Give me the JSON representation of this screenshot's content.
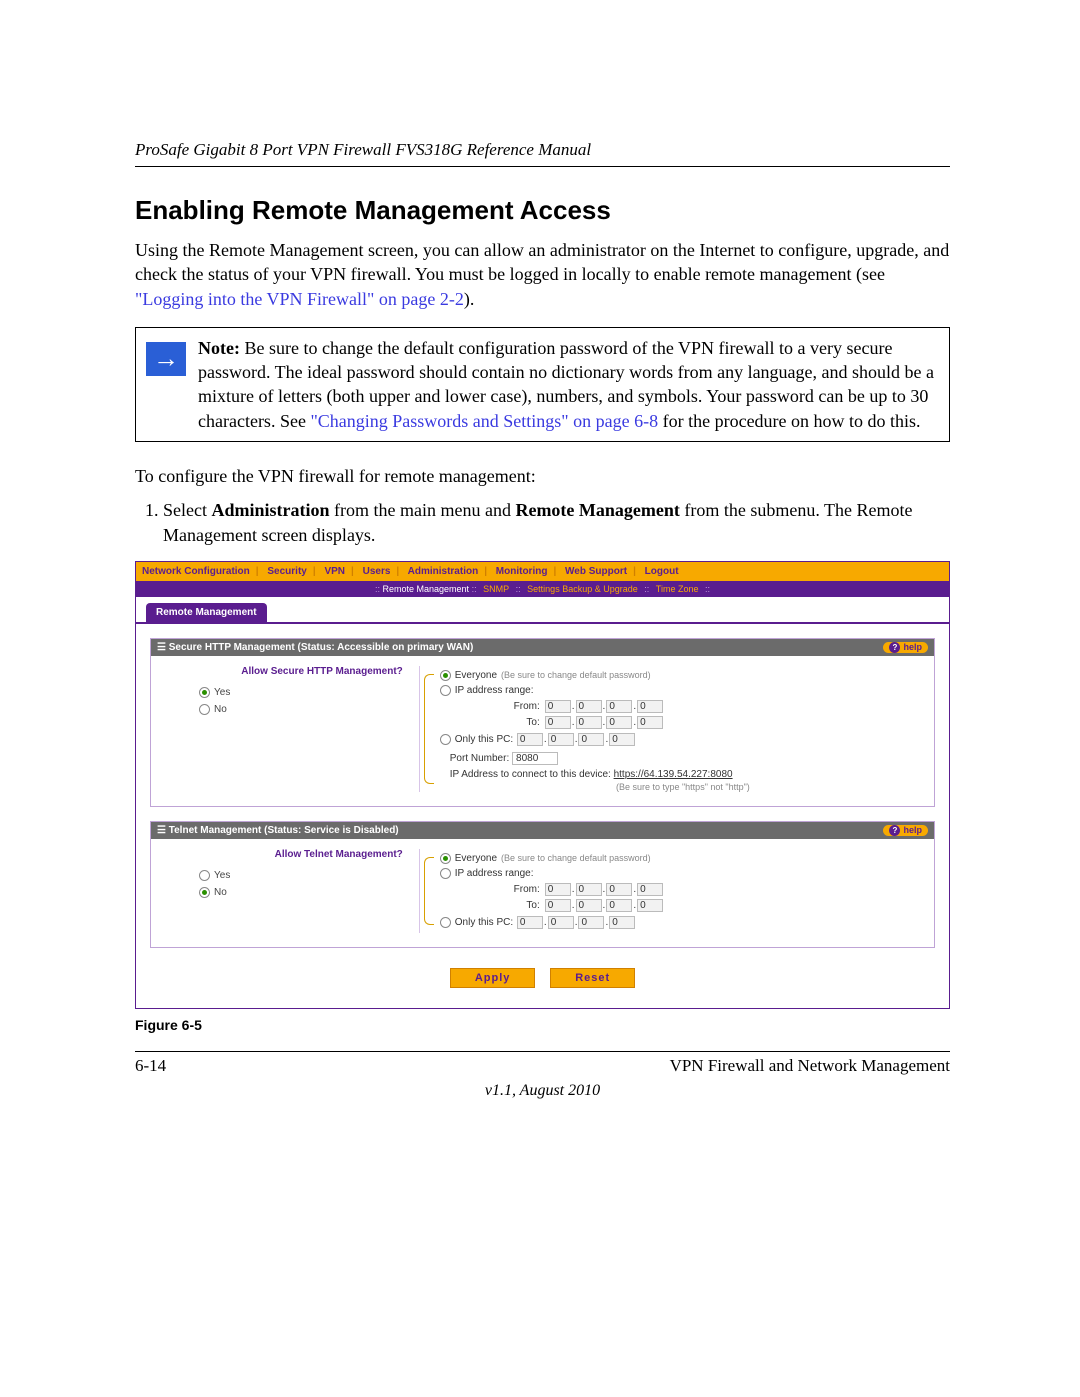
{
  "header": {
    "title": "ProSafe Gigabit 8 Port VPN Firewall FVS318G Reference Manual"
  },
  "section": {
    "heading": "Enabling Remote Management Access",
    "intro_1": "Using the Remote Management screen, you can allow an administrator on the Internet to configure, upgrade, and check the status of your VPN firewall. You must be logged in locally to enable remote management (see ",
    "intro_link": "\"Logging into the VPN Firewall\" on page 2-2",
    "intro_2": ").",
    "note_prefix": "Note:",
    "note_body_1": " Be sure to change the default configuration password of the VPN firewall to a very secure password. The ideal password should contain no dictionary words from any language, and should be a mixture of letters (both upper and lower case), numbers, and symbols. Your password can be up to 30 characters. See ",
    "note_link": "\"Changing Passwords and Settings\" on page 6-8",
    "note_body_2": " for the procedure on how to do this.",
    "config_intro": "To configure the VPN firewall for remote management:",
    "step1_a": "Select ",
    "step1_b": "Administration",
    "step1_c": " from the main menu and ",
    "step1_d": "Remote Management",
    "step1_e": " from the submenu. The Remote Management screen displays."
  },
  "ui": {
    "topnav": [
      "Network Configuration",
      "Security",
      "VPN",
      "Users",
      "Administration",
      "Monitoring",
      "Web Support",
      "Logout"
    ],
    "subnav": [
      "Remote Management",
      "SNMP",
      "Settings Backup & Upgrade",
      "Time Zone"
    ],
    "tab": "Remote Management",
    "panel1": {
      "title": "Secure HTTP Management (Status: Accessible on primary WAN)",
      "help": "help",
      "question": "Allow Secure HTTP Management?",
      "yes": "Yes",
      "no": "No",
      "opt_everyone": "Everyone",
      "hint_everyone": "(Be sure to change default password)",
      "opt_range": "IP address range:",
      "from": "From:",
      "to": "To:",
      "opt_only": "Only this PC:",
      "ip_zero": "0",
      "port_label": "Port Number:",
      "port_value": "8080",
      "connect_label": "IP Address to connect to this device:",
      "connect_url": "https://64.139.54.227:8080",
      "tiny": "(Be sure to type \"https\" not \"http\")"
    },
    "panel2": {
      "title": "Telnet Management (Status: Service is Disabled)",
      "help": "help",
      "question": "Allow Telnet Management?",
      "yes": "Yes",
      "no": "No",
      "opt_everyone": "Everyone",
      "hint_everyone": "(Be sure to change default password)",
      "opt_range": "IP address range:",
      "from": "From:",
      "to": "To:",
      "opt_only": "Only this PC:",
      "ip_zero": "0"
    },
    "apply": "Apply",
    "reset": "Reset"
  },
  "figure": "Figure 6-5",
  "footer": {
    "page": "6-14",
    "chapter": "VPN Firewall and Network Management",
    "version": "v1.1, August 2010"
  }
}
